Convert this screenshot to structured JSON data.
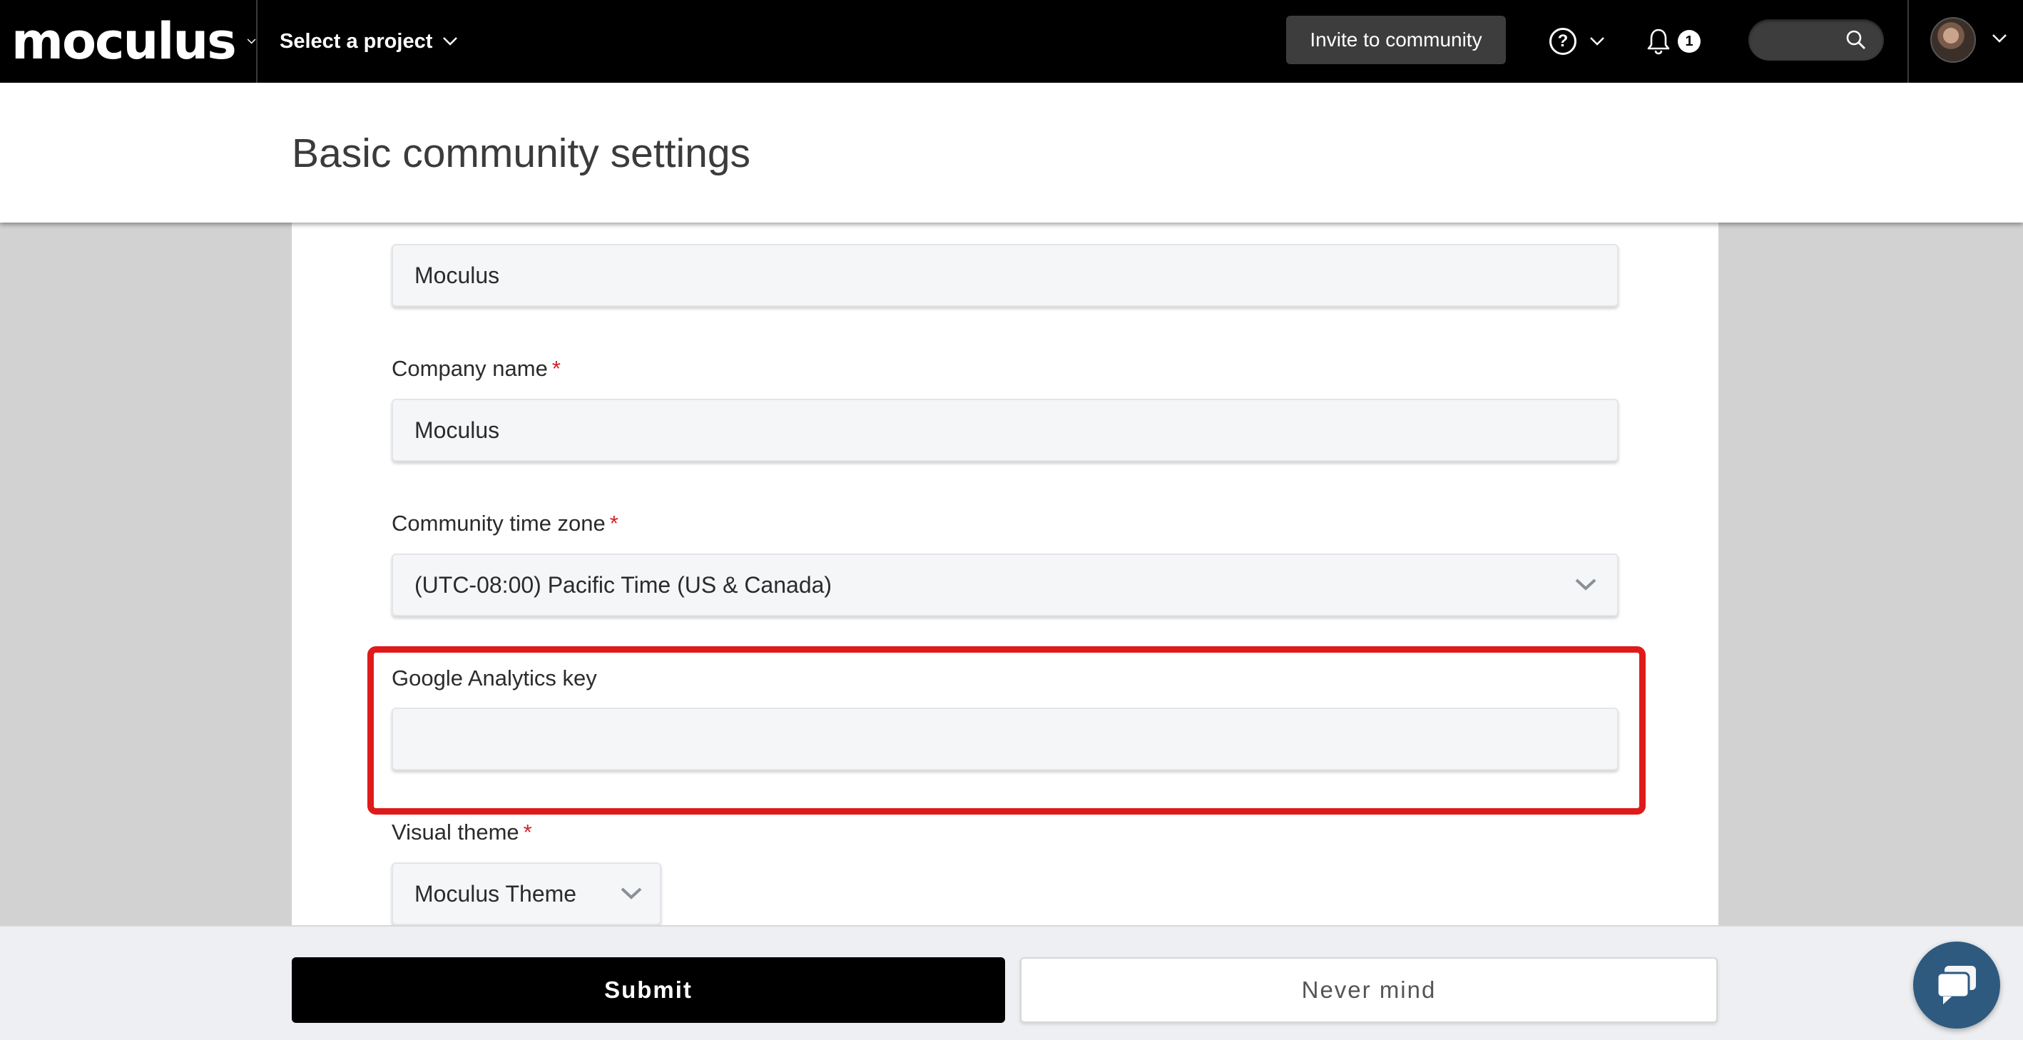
{
  "topbar": {
    "brand": "moculus",
    "project_select": "Select a project",
    "invite_button": "Invite to community",
    "help_icon": "help-circle-icon",
    "notifications": {
      "icon": "bell-icon",
      "count": "1"
    },
    "search_icon": "search-icon",
    "avatar_icon": "user-avatar"
  },
  "page": {
    "title": "Basic community settings"
  },
  "form": {
    "first_field_value": "Moculus",
    "company_name": {
      "label": "Company name",
      "required": "*",
      "value": "Moculus"
    },
    "time_zone": {
      "label": "Community time zone",
      "required": "*",
      "value": "(UTC-08:00) Pacific Time (US & Canada)"
    },
    "google_analytics": {
      "label": "Google Analytics key",
      "value": ""
    },
    "visual_theme": {
      "label": "Visual theme",
      "required": "*",
      "value": "Moculus Theme"
    }
  },
  "footer": {
    "submit": "Submit",
    "never_mind": "Never mind",
    "chat_icon": "chat-icon"
  },
  "colors": {
    "highlight": "#e01a1a",
    "required": "#d2232a",
    "chat": "#2e5a80"
  }
}
